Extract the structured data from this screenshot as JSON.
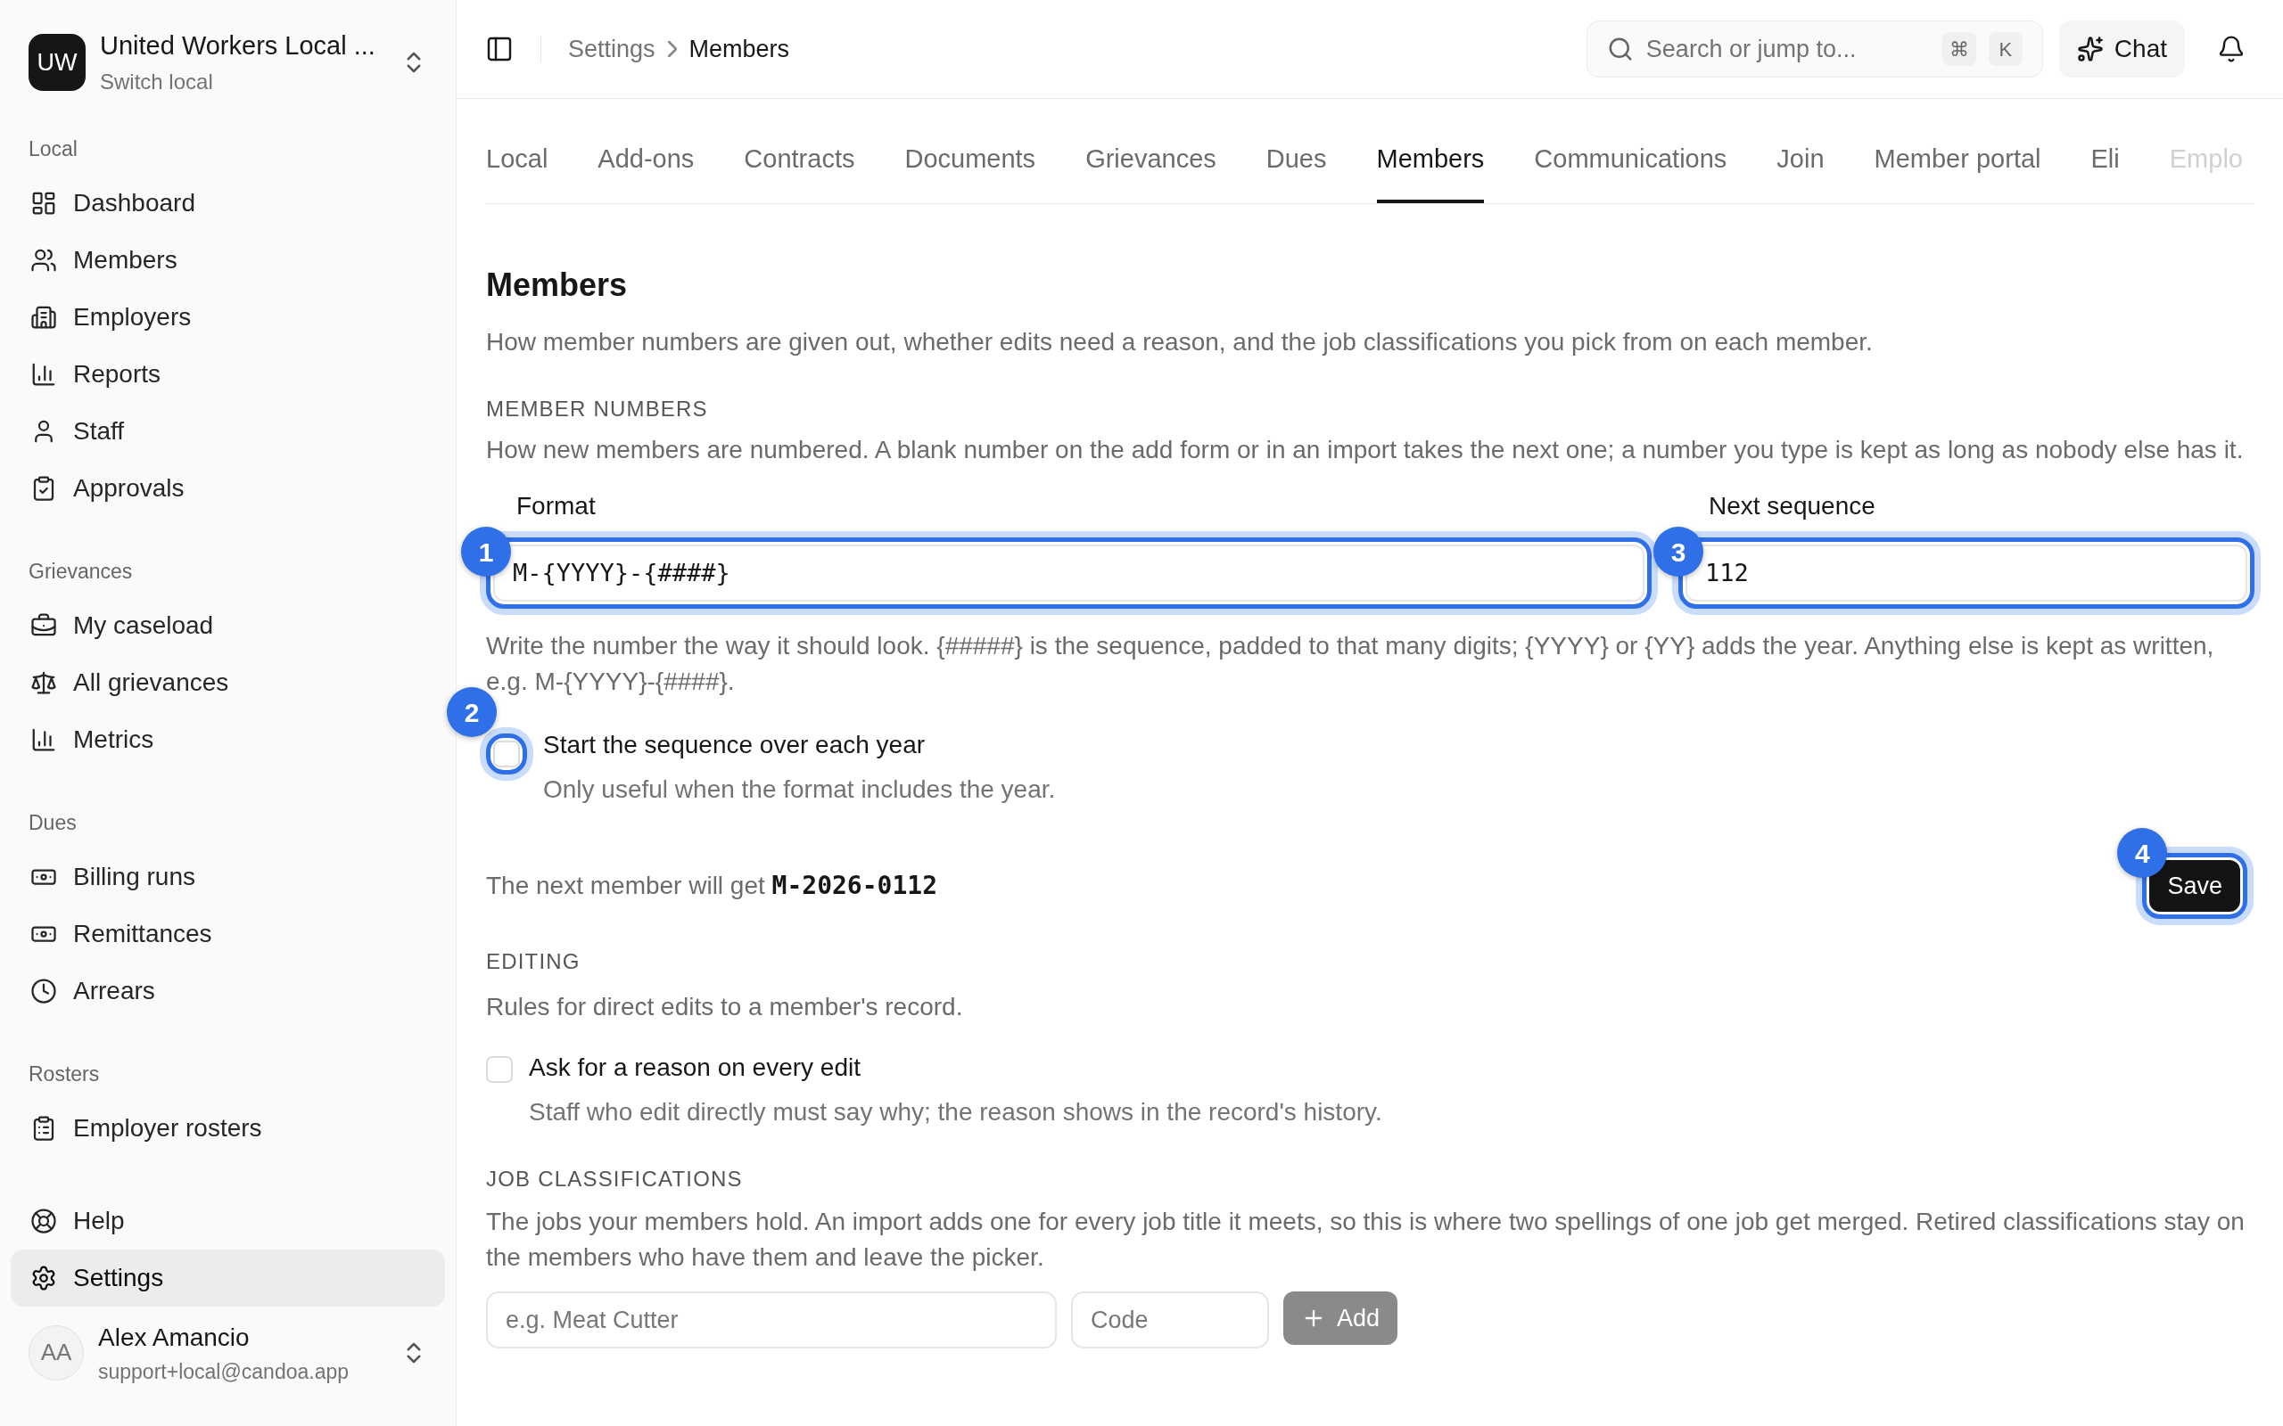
{
  "sidebar": {
    "org": {
      "initials": "UW",
      "name": "United Workers Local ...",
      "subtitle": "Switch local"
    },
    "sections": [
      {
        "title": "Local",
        "items": [
          {
            "label": "Dashboard",
            "selected": false
          },
          {
            "label": "Members",
            "selected": false
          },
          {
            "label": "Employers",
            "selected": false
          },
          {
            "label": "Reports",
            "selected": false
          },
          {
            "label": "Staff",
            "selected": false
          },
          {
            "label": "Approvals",
            "selected": false
          }
        ]
      },
      {
        "title": "Grievances",
        "items": [
          {
            "label": "My caseload",
            "selected": false
          },
          {
            "label": "All grievances",
            "selected": false
          },
          {
            "label": "Metrics",
            "selected": false
          }
        ]
      },
      {
        "title": "Dues",
        "items": [
          {
            "label": "Billing runs",
            "selected": false
          },
          {
            "label": "Remittances",
            "selected": false
          },
          {
            "label": "Arrears",
            "selected": false
          }
        ]
      },
      {
        "title": "Rosters",
        "items": [
          {
            "label": "Employer rosters",
            "selected": false
          }
        ]
      }
    ],
    "footer_items": [
      {
        "label": "Help",
        "selected": false
      },
      {
        "label": "Settings",
        "selected": true
      }
    ],
    "user": {
      "initials": "AA",
      "name": "Alex Amancio",
      "email": "support+local@candoa.app"
    }
  },
  "topbar": {
    "breadcrumbs": [
      "Settings",
      "Members"
    ],
    "search": {
      "placeholder": "Search or jump to...",
      "keys": [
        "⌘",
        "K"
      ]
    },
    "chat_label": "Chat"
  },
  "tabs": [
    {
      "label": "Local",
      "selected": false
    },
    {
      "label": "Add-ons",
      "selected": false
    },
    {
      "label": "Contracts",
      "selected": false
    },
    {
      "label": "Documents",
      "selected": false
    },
    {
      "label": "Grievances",
      "selected": false
    },
    {
      "label": "Dues",
      "selected": false
    },
    {
      "label": "Members",
      "selected": true
    },
    {
      "label": "Communications",
      "selected": false
    },
    {
      "label": "Join",
      "selected": false
    },
    {
      "label": "Member portal",
      "selected": false
    },
    {
      "label": "Eli",
      "selected": false
    },
    {
      "label": "Emplo",
      "selected": false
    }
  ],
  "page": {
    "title": "Members",
    "description": "How member numbers are given out, whether edits need a reason, and the job classifications you pick from on each member."
  },
  "member_numbers": {
    "heading": "MEMBER NUMBERS",
    "description": "How new members are numbered. A blank number on the add form or in an import takes the next one; a number you type is kept as long as nobody else has it.",
    "format": {
      "label": "Format",
      "value": "M-{YYYY}-{####}",
      "marker": "1"
    },
    "next_sequence": {
      "label": "Next sequence",
      "value": "112",
      "marker": "3"
    },
    "help": "Write the number the way it should look. {#####} is the sequence, padded to that many digits; {YYYY} or {YY} adds the year. Anything else is kept as written, e.g. M-{YYYY}-{####}.",
    "restart": {
      "label": "Start the sequence over each year",
      "hint": "Only useful when the format includes the year.",
      "checked": false,
      "marker": "2"
    },
    "preview_text": "The next member will get",
    "preview_value": "M-2026-0112",
    "save": {
      "label": "Save",
      "marker": "4"
    }
  },
  "editing": {
    "heading": "EDITING",
    "description": "Rules for direct edits to a member's record.",
    "reason": {
      "label": "Ask for a reason on every edit",
      "hint": "Staff who edit directly must say why; the reason shows in the record's history.",
      "checked": false
    }
  },
  "job_classifications": {
    "heading": "JOB CLASSIFICATIONS",
    "description": "The jobs your members hold. An import adds one for every job title it meets, so this is where two spellings of one job get merged. Retired classifications stay on the members who have them and leave the picker.",
    "name_placeholder": "e.g. Meat Cutter",
    "code_placeholder": "Code",
    "add_label": "Add"
  }
}
